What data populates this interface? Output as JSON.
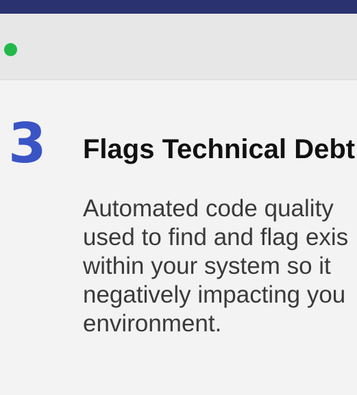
{
  "colors": {
    "top_strip": "#2a3270",
    "header": "#e7e7e7",
    "traffic_light": "#22b84a",
    "accent": "#3a54c5",
    "background": "#f3f3f3"
  },
  "step": {
    "number": "3",
    "title": "Flags Technical Debt",
    "body_lines": [
      "Automated code quality",
      "used to find and flag exis",
      "within your system so it",
      "negatively impacting you",
      "environment."
    ]
  }
}
